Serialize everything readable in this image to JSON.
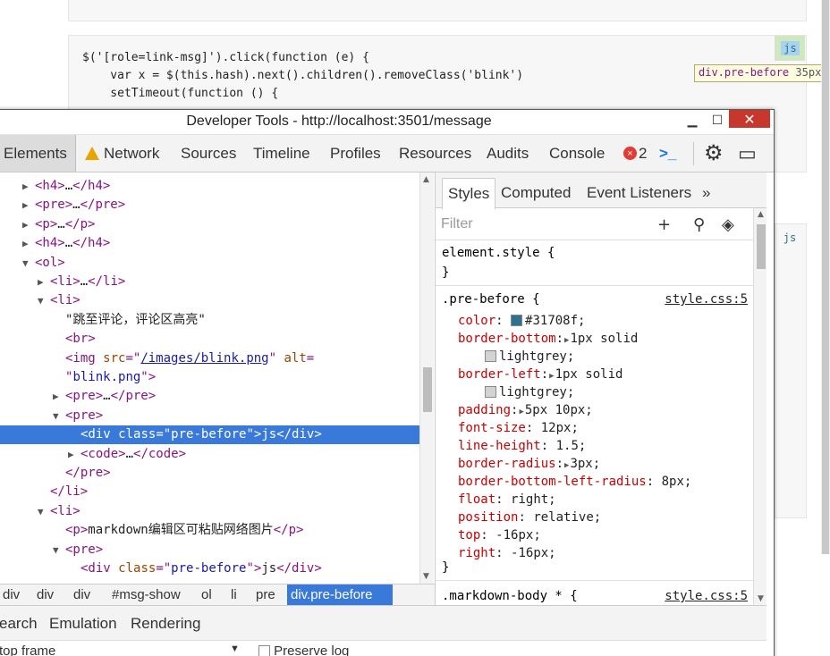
{
  "page": {
    "code_lines": [
      "$('[role=link-msg]').click(function (e) {",
      "    var x = $(this.hash).next().children().removeClass('blink')",
      "    setTimeout(function () {"
    ],
    "js_badge": "js",
    "js_badge_2": "js",
    "tooltip": {
      "tag": "div.pre-before",
      "size": "35px",
      "close": "×"
    }
  },
  "devtools": {
    "title": "Developer Tools - http://localhost:3501/message",
    "window_buttons": {
      "minimize": "▁",
      "maximize": "☐",
      "close": "✕"
    },
    "tabs": {
      "elements": "Elements",
      "network": "Network",
      "sources": "Sources",
      "timeline": "Timeline",
      "profiles": "Profiles",
      "resources": "Resources",
      "audits": "Audits",
      "console": "Console"
    },
    "error_count": "2",
    "console_glyph": ">_",
    "settings_glyph": "⚙",
    "dock_glyph": "▭",
    "tree": [
      {
        "indent": 0,
        "tri": "▶",
        "parts": [
          [
            "tg",
            "<h4>"
          ],
          [
            "tx",
            "…"
          ],
          [
            "tg",
            "</h4>"
          ]
        ]
      },
      {
        "indent": 0,
        "tri": "▶",
        "parts": [
          [
            "tg",
            "<pre>"
          ],
          [
            "tx",
            "…"
          ],
          [
            "tg",
            "</pre>"
          ]
        ]
      },
      {
        "indent": 0,
        "tri": "▶",
        "parts": [
          [
            "tg",
            "<p>"
          ],
          [
            "tx",
            "…"
          ],
          [
            "tg",
            "</p>"
          ]
        ]
      },
      {
        "indent": 0,
        "tri": "▶",
        "parts": [
          [
            "tg",
            "<h4>"
          ],
          [
            "tx",
            "…"
          ],
          [
            "tg",
            "</h4>"
          ]
        ]
      },
      {
        "indent": 0,
        "tri": "▼",
        "parts": [
          [
            "tg",
            "<ol>"
          ]
        ]
      },
      {
        "indent": 1,
        "tri": "▶",
        "parts": [
          [
            "tg",
            "<li>"
          ],
          [
            "tx",
            "…"
          ],
          [
            "tg",
            "</li>"
          ]
        ]
      },
      {
        "indent": 1,
        "tri": "▼",
        "parts": [
          [
            "tg",
            "<li>"
          ]
        ]
      },
      {
        "indent": 2,
        "tri": "",
        "parts": [
          [
            "tx",
            "\"跳至评论，评论区高亮\""
          ]
        ]
      },
      {
        "indent": 2,
        "tri": "",
        "parts": [
          [
            "tg",
            "<br>"
          ]
        ]
      },
      {
        "indent": 2,
        "tri": "",
        "parts": [
          [
            "tg",
            "<img "
          ],
          [
            "an",
            "src"
          ],
          [
            "tg",
            "=\""
          ],
          [
            "lnk",
            "/images/blink.png"
          ],
          [
            "tg",
            "\" "
          ],
          [
            "an",
            "alt"
          ],
          [
            "tg",
            "="
          ]
        ]
      },
      {
        "indent": 2,
        "tri": "",
        "parts": [
          [
            "tg",
            "\""
          ],
          [
            "av",
            "blink.png"
          ],
          [
            "tg",
            "\">"
          ]
        ]
      },
      {
        "indent": 2,
        "tri": "▶",
        "parts": [
          [
            "tg",
            "<pre>"
          ],
          [
            "tx",
            "…"
          ],
          [
            "tg",
            "</pre>"
          ]
        ]
      },
      {
        "indent": 2,
        "tri": "▼",
        "parts": [
          [
            "tg",
            "<pre>"
          ]
        ]
      },
      {
        "indent": 3,
        "tri": "",
        "selected": true,
        "parts": [
          [
            "tg",
            "<div "
          ],
          [
            "an",
            "class"
          ],
          [
            "tg",
            "=\""
          ],
          [
            "av",
            "pre-before"
          ],
          [
            "tg",
            "\">"
          ],
          [
            "tx",
            "js"
          ],
          [
            "tg",
            "</div>"
          ]
        ]
      },
      {
        "indent": 3,
        "tri": "▶",
        "parts": [
          [
            "tg",
            "<code>"
          ],
          [
            "tx",
            "…"
          ],
          [
            "tg",
            "</code>"
          ]
        ]
      },
      {
        "indent": 2,
        "tri": "",
        "parts": [
          [
            "tg",
            "</pre>"
          ]
        ]
      },
      {
        "indent": 1,
        "tri": "",
        "parts": [
          [
            "tg",
            "</li>"
          ]
        ]
      },
      {
        "indent": 1,
        "tri": "▼",
        "parts": [
          [
            "tg",
            "<li>"
          ]
        ]
      },
      {
        "indent": 2,
        "tri": "",
        "parts": [
          [
            "tg",
            "<p>"
          ],
          [
            "tx",
            "markdown编辑区可粘贴网络图片"
          ],
          [
            "tg",
            "</p>"
          ]
        ]
      },
      {
        "indent": 2,
        "tri": "▼",
        "parts": [
          [
            "tg",
            "<pre>"
          ]
        ]
      },
      {
        "indent": 3,
        "tri": "",
        "parts": [
          [
            "tg",
            "<div "
          ],
          [
            "an",
            "class"
          ],
          [
            "tg",
            "=\""
          ],
          [
            "av",
            "pre-before"
          ],
          [
            "tg",
            "\">"
          ],
          [
            "tx",
            "js"
          ],
          [
            "tg",
            "</div>"
          ]
        ]
      }
    ],
    "breadcrumbs": [
      "div",
      "div",
      "div",
      "#msg-show",
      "ol",
      "li",
      "pre",
      "div.pre-before"
    ],
    "sidebar_tabs": {
      "styles": "Styles",
      "computed": "Computed",
      "event_listeners": "Event Listeners",
      "more": "»"
    },
    "filter_placeholder": "Filter",
    "styles": {
      "element_style": "element.style {",
      "close_brace": "}",
      "rule1_selector": ".pre-before {",
      "rule1_source": "style.css:5",
      "rule1_props": [
        {
          "name": "color",
          "value": "#31708f;",
          "swatch": "#31708f",
          "expand": false
        },
        {
          "name": "border-bottom",
          "value": "1px solid",
          "expand": true
        },
        {
          "name": "",
          "value": "lightgrey;",
          "swatch": "#d3d3d3",
          "expand": false,
          "cont": true
        },
        {
          "name": "border-left",
          "value": "1px solid",
          "expand": true
        },
        {
          "name": "",
          "value": "lightgrey;",
          "swatch": "#d3d3d3",
          "expand": false,
          "cont": true
        },
        {
          "name": "padding",
          "value": "5px 10px;",
          "expand": true
        },
        {
          "name": "font-size",
          "value": "12px;",
          "expand": false
        },
        {
          "name": "line-height",
          "value": "1.5;",
          "expand": false
        },
        {
          "name": "border-radius",
          "value": "3px;",
          "expand": true
        },
        {
          "name": "border-bottom-left-radius",
          "value": "8px;",
          "expand": false
        },
        {
          "name": "float",
          "value": "right;",
          "expand": false
        },
        {
          "name": "position",
          "value": "relative;",
          "expand": false
        },
        {
          "name": "top",
          "value": "-16px;",
          "expand": false
        },
        {
          "name": "right",
          "value": "-16px;",
          "expand": false
        }
      ],
      "rule2_selector": ".markdown-body * {",
      "rule2_source": "style.css:5"
    },
    "drawer_tabs": {
      "search": "earch",
      "emulation": "Emulation",
      "rendering": "Rendering"
    },
    "drawer_row": {
      "frame": "top frame",
      "preserve_log": "Preserve log"
    }
  }
}
